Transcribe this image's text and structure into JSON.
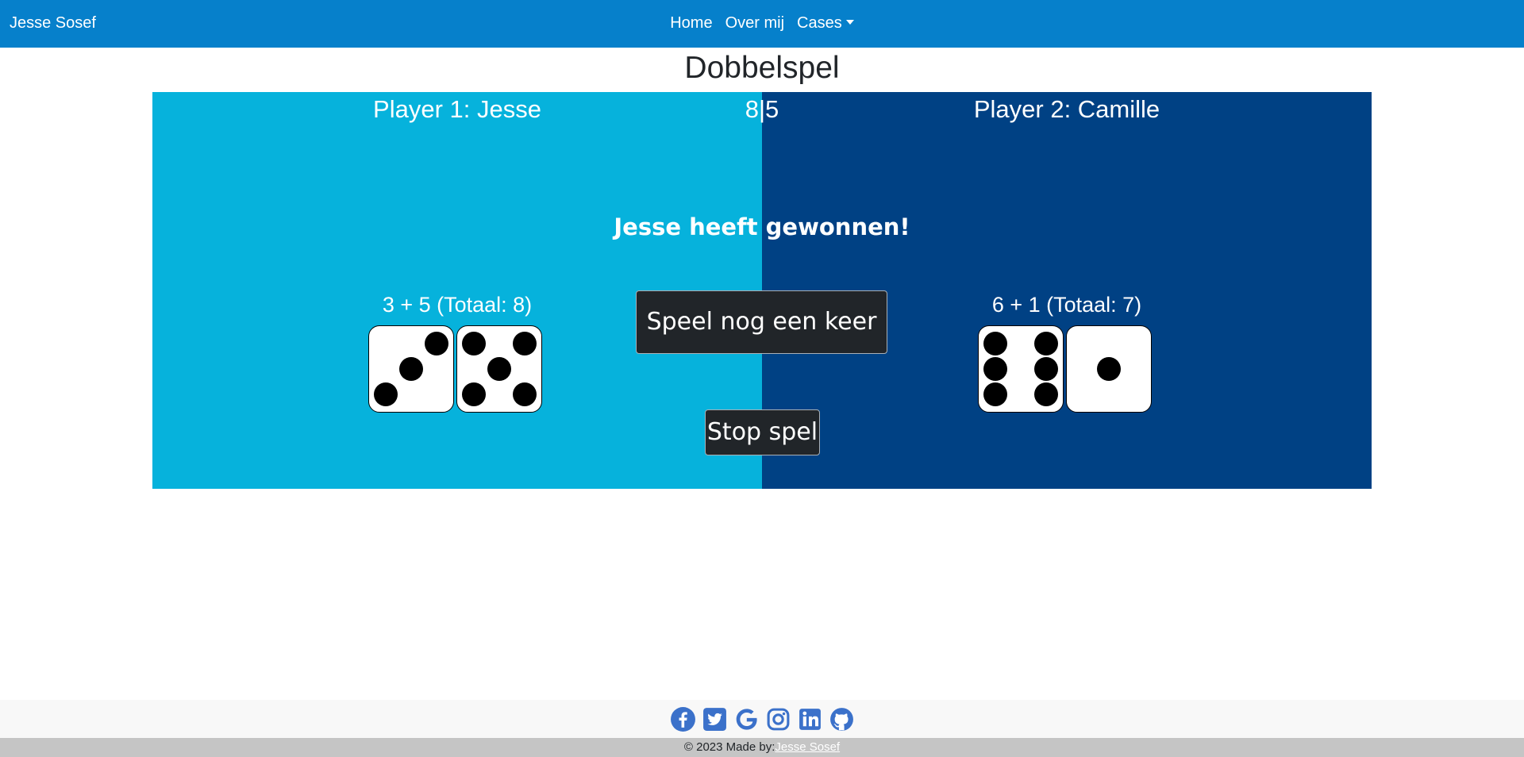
{
  "navbar": {
    "brand": "Jesse Sosef",
    "links": [
      "Home",
      "Over mij",
      "Cases"
    ],
    "accent_color": "#0680cb"
  },
  "page": {
    "title": "Dobbelspel"
  },
  "game": {
    "player1": {
      "label": "Player 1: Jesse",
      "roll_text": "3 + 5 (Totaal: 8)",
      "dice": [
        3,
        5
      ],
      "background": "#06b2dc"
    },
    "player2": {
      "label": "Player 2: Camille",
      "roll_text": "6 + 1 (Totaal: 7)",
      "dice": [
        6,
        1
      ],
      "background": "#004184"
    },
    "score": {
      "left": "8",
      "right": "5"
    },
    "winner_text": "Jesse heeft gewonnen!",
    "play_again_label": "Speel nog een keer",
    "stop_label": "Stop spel"
  },
  "footer": {
    "social_icons": [
      "facebook-icon",
      "twitter-icon",
      "google-icon",
      "instagram-icon",
      "linkedin-icon",
      "github-icon"
    ],
    "icon_color": "#3b71ca",
    "copyright_prefix": "© 2023 Made by:",
    "author": "Jesse Sosef"
  }
}
